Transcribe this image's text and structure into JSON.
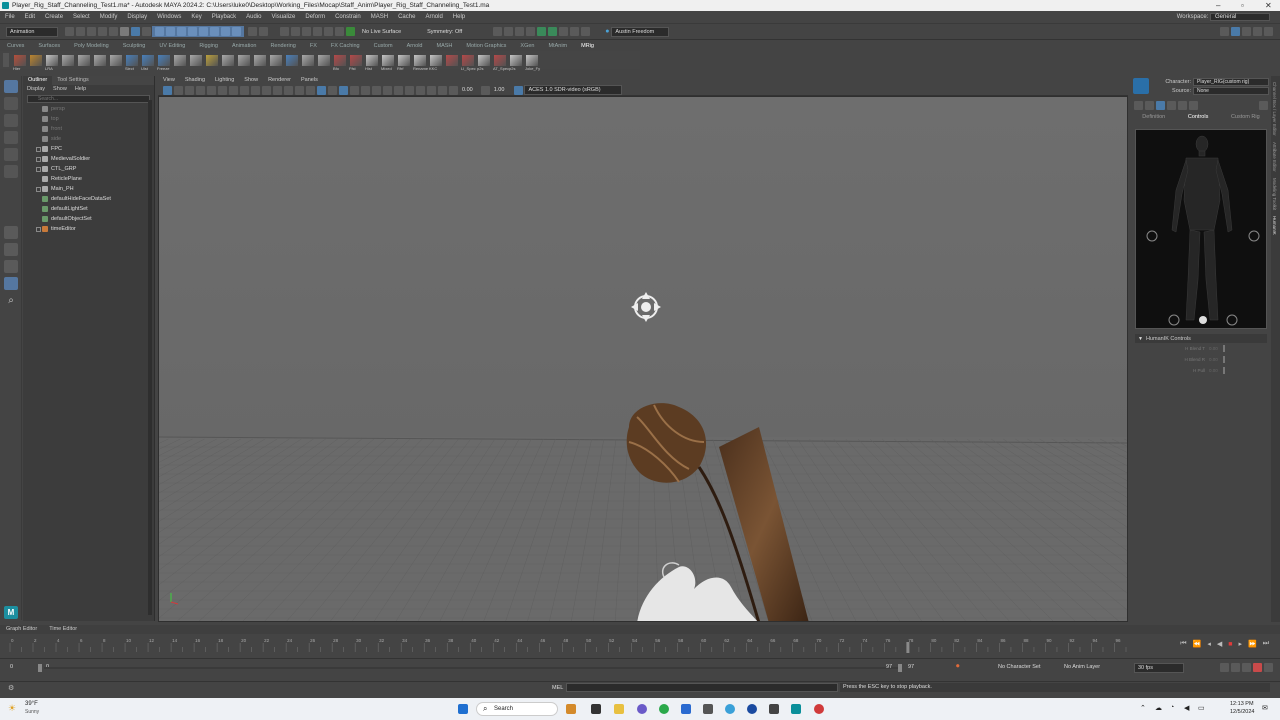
{
  "window": {
    "title": "Player_Rig_Staff_Channeling_Test1.ma* - Autodesk MAYA 2024.2: C:\\Users\\luke0\\Desktop\\Working_Files\\Mocap\\Staff_Anim\\Player_Rig_Staff_Channeling_Test1.ma"
  },
  "menubar": {
    "items": [
      "File",
      "Edit",
      "Create",
      "Select",
      "Modify",
      "Display",
      "Windows",
      "Key",
      "Playback",
      "Audio",
      "Visualize",
      "Deform",
      "Constrain",
      "MASH",
      "Cache",
      "Arnold",
      "Help"
    ],
    "workspace_label": "Workspace:",
    "workspace_value": "General"
  },
  "statusline": {
    "menuset": "Animation",
    "live_surface": "No Live Surface",
    "symmetry": "Symmetry: Off",
    "user": "Austin Freedom"
  },
  "shelf": {
    "tabs": [
      "Curves",
      "Surfaces",
      "Poly Modeling",
      "Sculpting",
      "UV Editing",
      "Rigging",
      "Animation",
      "Rendering",
      "FX",
      "FX Caching",
      "Custom",
      "Arnold",
      "MASH",
      "Motion Graphics",
      "XGen",
      "MtAnim",
      "MRig"
    ],
    "active_tab": "MRig",
    "icon_labels": [
      "Hier",
      "",
      "LRA",
      "",
      "",
      "",
      "",
      "Slect",
      "Ulst",
      "Freeze",
      "",
      "",
      "",
      "",
      "",
      "",
      "",
      "",
      "",
      "",
      "Bfo",
      "Ffst",
      "Hist",
      "Mixed",
      "Rfrf",
      "Rename",
      "KKC",
      "",
      "LI_Spec",
      "p2s",
      "AT_Spec",
      "p2s",
      "Joke_Fy"
    ]
  },
  "outliner": {
    "tabs": [
      "Outliner",
      "Tool Settings"
    ],
    "menu": [
      "Display",
      "Show",
      "Help"
    ],
    "search_placeholder": "Search...",
    "items": [
      {
        "label": "persp",
        "dim": true,
        "expand": false,
        "color": "#888"
      },
      {
        "label": "top",
        "dim": true,
        "expand": false,
        "color": "#888"
      },
      {
        "label": "front",
        "dim": true,
        "expand": false,
        "color": "#888"
      },
      {
        "label": "side",
        "dim": true,
        "expand": false,
        "color": "#888"
      },
      {
        "label": "FPC",
        "dim": false,
        "expand": true,
        "color": "#aaa"
      },
      {
        "label": "MedievalSoldier",
        "dim": false,
        "expand": true,
        "color": "#aaa"
      },
      {
        "label": "CTL_GRP",
        "dim": false,
        "expand": true,
        "color": "#aaa"
      },
      {
        "label": "ReticlePlane",
        "dim": false,
        "expand": false,
        "color": "#aaa"
      },
      {
        "label": "Main_PH",
        "dim": false,
        "expand": true,
        "color": "#aaa"
      },
      {
        "label": "defaultHideFaceDataSet",
        "dim": false,
        "expand": false,
        "color": "#6a9a6a"
      },
      {
        "label": "defaultLightSet",
        "dim": false,
        "expand": false,
        "color": "#6a9a6a"
      },
      {
        "label": "defaultObjectSet",
        "dim": false,
        "expand": false,
        "color": "#6a9a6a"
      },
      {
        "label": "timeEditor",
        "dim": false,
        "expand": true,
        "color": "#c87a3a"
      }
    ]
  },
  "viewport": {
    "menu": [
      "View",
      "Shading",
      "Lighting",
      "Show",
      "Renderer",
      "Panels"
    ],
    "near_value": "0.00",
    "far_value": "1.00",
    "color_space": "ACES 1.0 SDR-video (sRGB)"
  },
  "hik": {
    "character_label": "Character:",
    "character_value": "Player_RIG(custom rig)",
    "source_label": "Source:",
    "source_value": "None",
    "tabs": [
      "Definition",
      "Controls",
      "Custom Rig"
    ],
    "active_tab": "Controls",
    "controls_header": "HumanIK Controls",
    "sliders": [
      {
        "label": "H Blend T",
        "value": "0.00"
      },
      {
        "label": "H Blend R",
        "value": "0.00"
      },
      {
        "label": "H Pull",
        "value": "0.00"
      }
    ],
    "side_tabs": [
      "Channel Box / Layer Editor",
      "Attribute Editor",
      "Modeling Toolkit",
      "HumanIK"
    ]
  },
  "timeline": {
    "tabs": [
      "Graph Editor",
      "Time Editor"
    ],
    "ticks": [
      "0",
      "2",
      "4",
      "6",
      "8",
      "10",
      "12",
      "14",
      "16",
      "18",
      "20",
      "22",
      "24",
      "26",
      "28",
      "30",
      "32",
      "34",
      "36",
      "38",
      "40",
      "42",
      "44",
      "46",
      "48",
      "50",
      "52",
      "54",
      "56",
      "58",
      "60",
      "62",
      "64",
      "66",
      "68",
      "70",
      "72",
      "74",
      "76",
      "78",
      "80",
      "82",
      "84",
      "86",
      "88",
      "90",
      "92",
      "94",
      "96"
    ],
    "current_frame": "78",
    "start_frame": "0",
    "range_start": "0",
    "range_end": "97",
    "end_frame": "97",
    "character_set": "No Character Set",
    "anim_layer": "No Anim Layer",
    "fps": "30 fps"
  },
  "cmdline": {
    "language": "MEL",
    "help_text": "Press the ESC key to stop playback."
  },
  "taskbar": {
    "weather_temp": "39°F",
    "weather_desc": "Sunny",
    "search_label": "Search",
    "time": "12:13 PM",
    "date": "12/5/2024"
  }
}
